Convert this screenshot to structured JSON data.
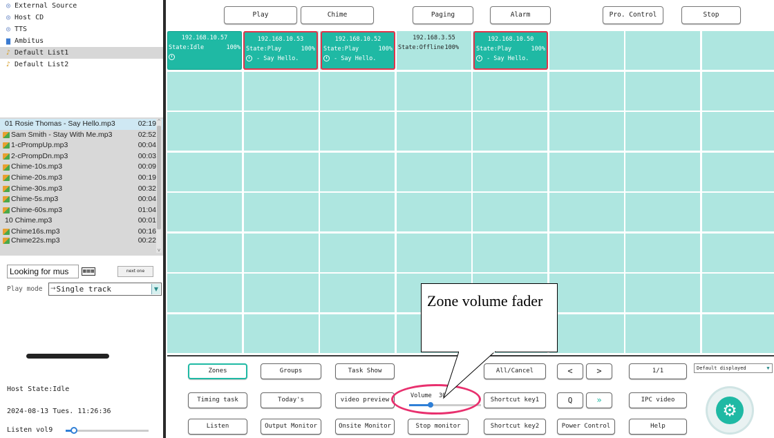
{
  "sources": [
    {
      "label": "External Source",
      "icon": "cd-icon"
    },
    {
      "label": "Host CD",
      "icon": "cd-icon"
    },
    {
      "label": "TTS",
      "icon": "cd-icon"
    },
    {
      "label": "Ambitus",
      "icon": "folder-icon"
    },
    {
      "label": "Default List1",
      "icon": "playlist-icon",
      "selected": true
    },
    {
      "label": "Default List2",
      "icon": "playlist-icon"
    }
  ],
  "playlist": [
    {
      "name": "01 Rosie Thomas - Say Hello.mp3",
      "duration": "02:19"
    },
    {
      "name": "Sam Smith - Stay With Me.mp3",
      "duration": "02:52"
    },
    {
      "name": "1-cPrompUp.mp3",
      "duration": "00:04"
    },
    {
      "name": "2-cPrompDn.mp3",
      "duration": "00:03"
    },
    {
      "name": "Chime-10s.mp3",
      "duration": "00:09"
    },
    {
      "name": "Chime-20s.mp3",
      "duration": "00:19"
    },
    {
      "name": "Chime-30s.mp3",
      "duration": "00:32"
    },
    {
      "name": "Chime-5s.mp3",
      "duration": "00:04"
    },
    {
      "name": "Chime-60s.mp3",
      "duration": "01:04"
    },
    {
      "name": "10 Chime.mp3",
      "duration": "00:01"
    },
    {
      "name": "Chime16s.mp3",
      "duration": "00:16"
    },
    {
      "name": "Chime22s.mp3",
      "duration": "00:22"
    }
  ],
  "search": {
    "value": "Looking for mus",
    "next_label": "next one"
  },
  "play_mode": {
    "label": "Play mode",
    "value": "Single track"
  },
  "status": {
    "host_state": "Host State:Idle",
    "datetime": "2024-08-13 Tues. 11:26:36",
    "listen_label": "Listen vol9",
    "listen_level": 0.1
  },
  "top_buttons": [
    "Play",
    "Chime",
    "Paging",
    "Alarm",
    "Pro. Control",
    "Stop"
  ],
  "zones": [
    {
      "ip": "192.168.10.57",
      "state": "State:Idle",
      "volume": "100%",
      "song": "",
      "status": "idle"
    },
    {
      "ip": "192.168.10.53",
      "state": "State:Play",
      "volume": "100%",
      "song": "- Say Hello.",
      "status": "playing"
    },
    {
      "ip": "192.168.10.52",
      "state": "State:Play",
      "volume": "100%",
      "song": "- Say Hello.",
      "status": "playing"
    },
    {
      "ip": "192.168.3.55",
      "state": "State:Offline",
      "volume": "100%",
      "song": "",
      "status": "offline"
    },
    {
      "ip": "192.168.10.50",
      "state": "State:Play",
      "volume": "100%",
      "song": "- Say Hello.",
      "status": "playing"
    }
  ],
  "bottom_buttons": {
    "zones": "Zones",
    "groups": "Groups",
    "task_show": "Task Show",
    "all_cancel": "All/Cancel",
    "prev": "<",
    "next": ">",
    "page": "1/1",
    "timing_task": "Timing task",
    "todays": "Today's",
    "video_preview": "video preview",
    "shortcut1": "Shortcut key1",
    "search_glyph": "Q",
    "ff_glyph": "»",
    "ipc_video": "IPC video",
    "listen": "Listen",
    "output_monitor": "Output Monitor",
    "onsite_monitor": "Onsite Monitor",
    "stop_monitor": "Stop monitor",
    "shortcut2": "Shortcut key2",
    "power_control": "Power Control",
    "help": "Help"
  },
  "display_select": {
    "value": "Default displayed"
  },
  "volume": {
    "label": "Volume",
    "value": "30",
    "level": 0.3
  },
  "callout": {
    "text": "Zone volume fader"
  },
  "colors": {
    "zone_on": "#1fb9a4",
    "zone_empty": "#aee6e0",
    "playing_border": "#e0344a",
    "highlight_ellipse": "#e8306e"
  }
}
